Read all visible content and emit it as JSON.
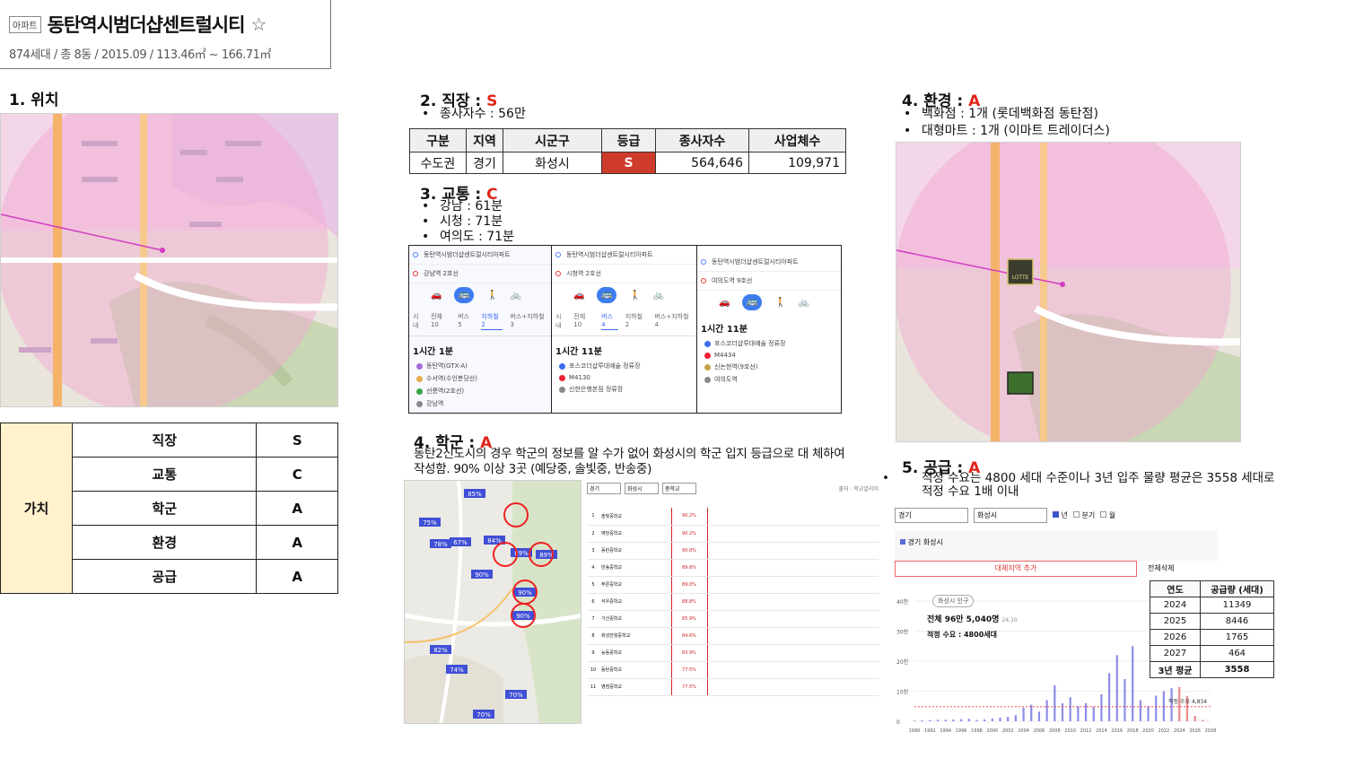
{
  "header": {
    "type_tag": "아파트",
    "name": "동탄역시범더샵센트럴시티",
    "star": "☆",
    "summary": "874세대 / 총 8동 / 2015.09 / 113.46㎡ ~ 166.71㎡"
  },
  "s1": {
    "title": "1. 위치"
  },
  "value_table": {
    "header": "가치",
    "rows": [
      {
        "label": "직장",
        "grade": "S"
      },
      {
        "label": "교통",
        "grade": "C"
      },
      {
        "label": "학군",
        "grade": "A"
      },
      {
        "label": "환경",
        "grade": "A"
      },
      {
        "label": "공급",
        "grade": "A"
      }
    ]
  },
  "s2": {
    "title": "2. 직장 : ",
    "grade": "S",
    "bullet": "종사자수 : 56만",
    "table": {
      "headers": [
        "구분",
        "지역",
        "시군구",
        "등급",
        "종사자수",
        "사업체수"
      ],
      "row": [
        "수도권",
        "경기",
        "화성시",
        "S",
        "564,646",
        "109,971"
      ]
    }
  },
  "s3": {
    "title": "3. 교통 : ",
    "grade": "C",
    "bullets": [
      "강남 : 61분",
      "시청 : 71분",
      "여의도 : 71분"
    ],
    "panels": [
      {
        "origin": "동탄역시범더샵센트럴시티아파트",
        "dest": "강남역 2호선",
        "time": "1시간 1분",
        "tabs": [
          "시내",
          "전체 10",
          "버스 5",
          "지하철 2",
          "버스+지하철 3"
        ],
        "lines": [
          "동탄역(GTX-A)",
          "수서역(수인분당선)",
          "선릉역(2호선)",
          "강남역"
        ]
      },
      {
        "origin": "동탄역시범더샵센트럴시티아파트",
        "dest": "시청역 2호선",
        "time": "1시간 11분",
        "tabs": [
          "시내",
          "전체 10",
          "버스 4",
          "지하철 2",
          "버스+지하철 4"
        ],
        "lines": [
          "포스코더샵루대예술 정류장",
          "M4130",
          "신한은행본점 정류장"
        ]
      },
      {
        "origin": "동탄역시범더샵센트럴시티아파트",
        "dest": "여의도역 9호선",
        "time": "1시간 11분",
        "tabs": [],
        "lines": [
          "포스코더샵루대예술 정류장",
          "M4434",
          "신논현역(9호선)",
          "여의도역"
        ]
      }
    ]
  },
  "s4": {
    "title": "4. 학군 : ",
    "grade": "A",
    "desc": "동탄2신도시의 경우 학군의 정보를 알 수가 없어 화성시의 학군 입지 등급으로 대 체하여 작성함. 90% 이상 3곳 (예당중, 솔빛중, 반송중)",
    "map_badges": [
      "85%",
      "75%",
      "78%",
      "67%",
      "84%",
      "89%",
      "90%",
      "89%",
      "90%",
      "90%",
      "82%",
      "74%",
      "70%",
      "70%"
    ],
    "filters": [
      "경기",
      "화성시",
      "중학교"
    ],
    "source": "출처 : 학교알리미",
    "schools": [
      {
        "rank": "1",
        "name": "솔빛중학교",
        "pct": "90.2%"
      },
      {
        "rank": "2",
        "name": "예당중학교",
        "pct": "90.2%"
      },
      {
        "rank": "3",
        "name": "동탄중학교",
        "pct": "90.0%"
      },
      {
        "rank": "4",
        "name": "반송중학교",
        "pct": "89.6%"
      },
      {
        "rank": "5",
        "name": "푸른중학교",
        "pct": "89.0%"
      },
      {
        "rank": "6",
        "name": "석우중학교",
        "pct": "88.8%"
      },
      {
        "rank": "7",
        "name": "기산중학교",
        "pct": "85.9%"
      },
      {
        "rank": "8",
        "name": "화성반월중학교",
        "pct": "84.6%"
      },
      {
        "rank": "9",
        "name": "능동중학교",
        "pct": "83.9%"
      },
      {
        "rank": "10",
        "name": "동탄중학교",
        "pct": "77.5%"
      },
      {
        "rank": "11",
        "name": "병점중학교",
        "pct": "77.5%"
      }
    ]
  },
  "s5_env": {
    "title": "4. 환경 : ",
    "grade": "A",
    "bullets": [
      "백화점 : 1개 (롯데백화점 동탄점)",
      "대형마트 : 1개 (이마트 트레이더스)"
    ],
    "logo_text": "LOTTE"
  },
  "s6": {
    "title": "5. 공급 : ",
    "grade": "A",
    "desc": "적정 수요는 4800 세대 수준이나 3년 입주 물량 평균은 3558 세대로 적정 수요 1배 이내",
    "filters": [
      "경기",
      "화성시"
    ],
    "filter_opts": [
      "년",
      "분기",
      "월"
    ],
    "legend": "경기 화성시",
    "add_btn": "대체지역 추가",
    "clear_btn": "전체삭제",
    "pop_tag": "화성시 인구",
    "pop_text": "전체 96만 5,040명",
    "pop_date": "24.10",
    "demand_text": "적정 수요 : 4800세대",
    "demand_label": "적정 수요 4,834",
    "supply_table": {
      "headers": [
        "연도",
        "공급량 (세대)"
      ],
      "rows": [
        [
          "2024",
          "11349"
        ],
        [
          "2025",
          "8446"
        ],
        [
          "2026",
          "1765"
        ],
        [
          "2027",
          "464"
        ],
        [
          "3년 평균",
          "3558"
        ]
      ]
    },
    "chart_data": {
      "type": "bar",
      "title": "",
      "y_ticks": [
        "40천",
        "30천",
        "20천",
        "10천",
        "0"
      ],
      "ylim": [
        0,
        40000
      ],
      "x_ticks": [
        "1990",
        "1992",
        "1994",
        "1996",
        "1998",
        "2000",
        "2002",
        "2004",
        "2006",
        "2008",
        "2010",
        "2012",
        "2014",
        "2016",
        "2018",
        "2020",
        "2022",
        "2024",
        "2026",
        "2028"
      ],
      "categories": [
        1990,
        1991,
        1992,
        1993,
        1994,
        1995,
        1996,
        1997,
        1998,
        1999,
        2000,
        2001,
        2002,
        2003,
        2004,
        2005,
        2006,
        2007,
        2008,
        2009,
        2010,
        2011,
        2012,
        2013,
        2014,
        2015,
        2016,
        2017,
        2018,
        2019,
        2020,
        2021,
        2022,
        2023,
        2024,
        2025,
        2026,
        2027
      ],
      "values": [
        200,
        300,
        400,
        500,
        500,
        600,
        700,
        800,
        400,
        600,
        900,
        1200,
        1500,
        2000,
        4500,
        5500,
        3200,
        7000,
        12000,
        6000,
        8000,
        5000,
        6000,
        4800,
        9000,
        16000,
        22000,
        14000,
        25000,
        7000,
        5000,
        8500,
        10000,
        11000,
        11349,
        8446,
        1765,
        464
      ],
      "demand": 4834
    }
  }
}
